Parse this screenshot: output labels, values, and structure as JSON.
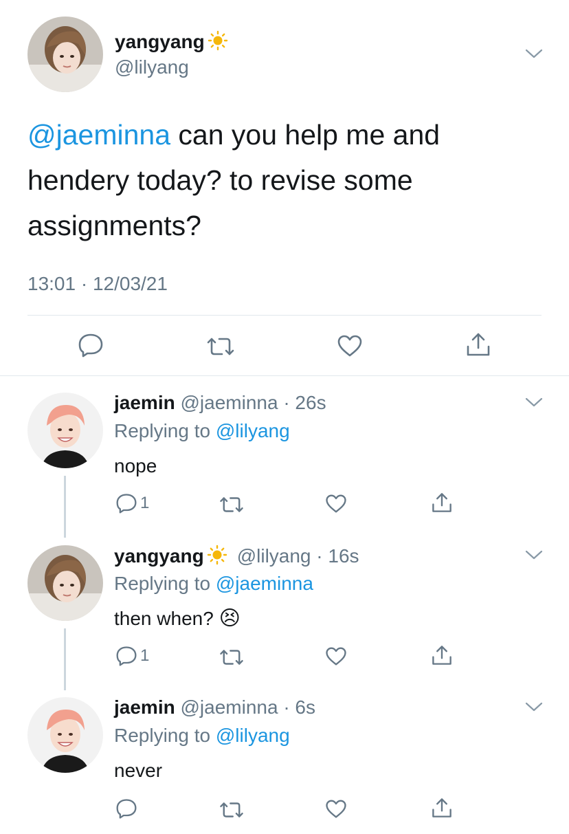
{
  "main_tweet": {
    "name": "yangyang",
    "handle": "@lilyang",
    "mention": "@jaeminna",
    "text": " can you help me and hendery today? to revise some assignments?",
    "timestamp": "13:01 · 12/03/21",
    "avatar": "avatar-yangyang"
  },
  "replies": [
    {
      "name": "jaemin",
      "handle": "@jaeminna",
      "time": "· 26s",
      "replying_prefix": "Replying to ",
      "replying_to": "@lilyang",
      "text": "nope",
      "reply_count": "1",
      "avatar": "avatar-jaemin"
    },
    {
      "name": "yangyang",
      "handle": "@lilyang",
      "time": "· 16s",
      "replying_prefix": "Replying to ",
      "replying_to": "@jaeminna",
      "text": "then when?",
      "emoji": "😣",
      "reply_count": "1",
      "avatar": "avatar-yangyang"
    },
    {
      "name": "jaemin",
      "handle": "@jaeminna",
      "time": "· 6s",
      "replying_prefix": "Replying to ",
      "replying_to": "@lilyang",
      "text": "never",
      "reply_count": "",
      "avatar": "avatar-jaemin"
    }
  ],
  "icons": {
    "sun_badge": "sun-icon",
    "more": "chevron-down-icon",
    "reply": "reply-icon",
    "retweet": "retweet-icon",
    "like": "heart-icon",
    "share": "share-icon"
  },
  "colors": {
    "link": "#1b95e0",
    "muted": "#657786",
    "text": "#14171a",
    "divider": "#e1e8ed",
    "sun": "#f5b70a"
  }
}
